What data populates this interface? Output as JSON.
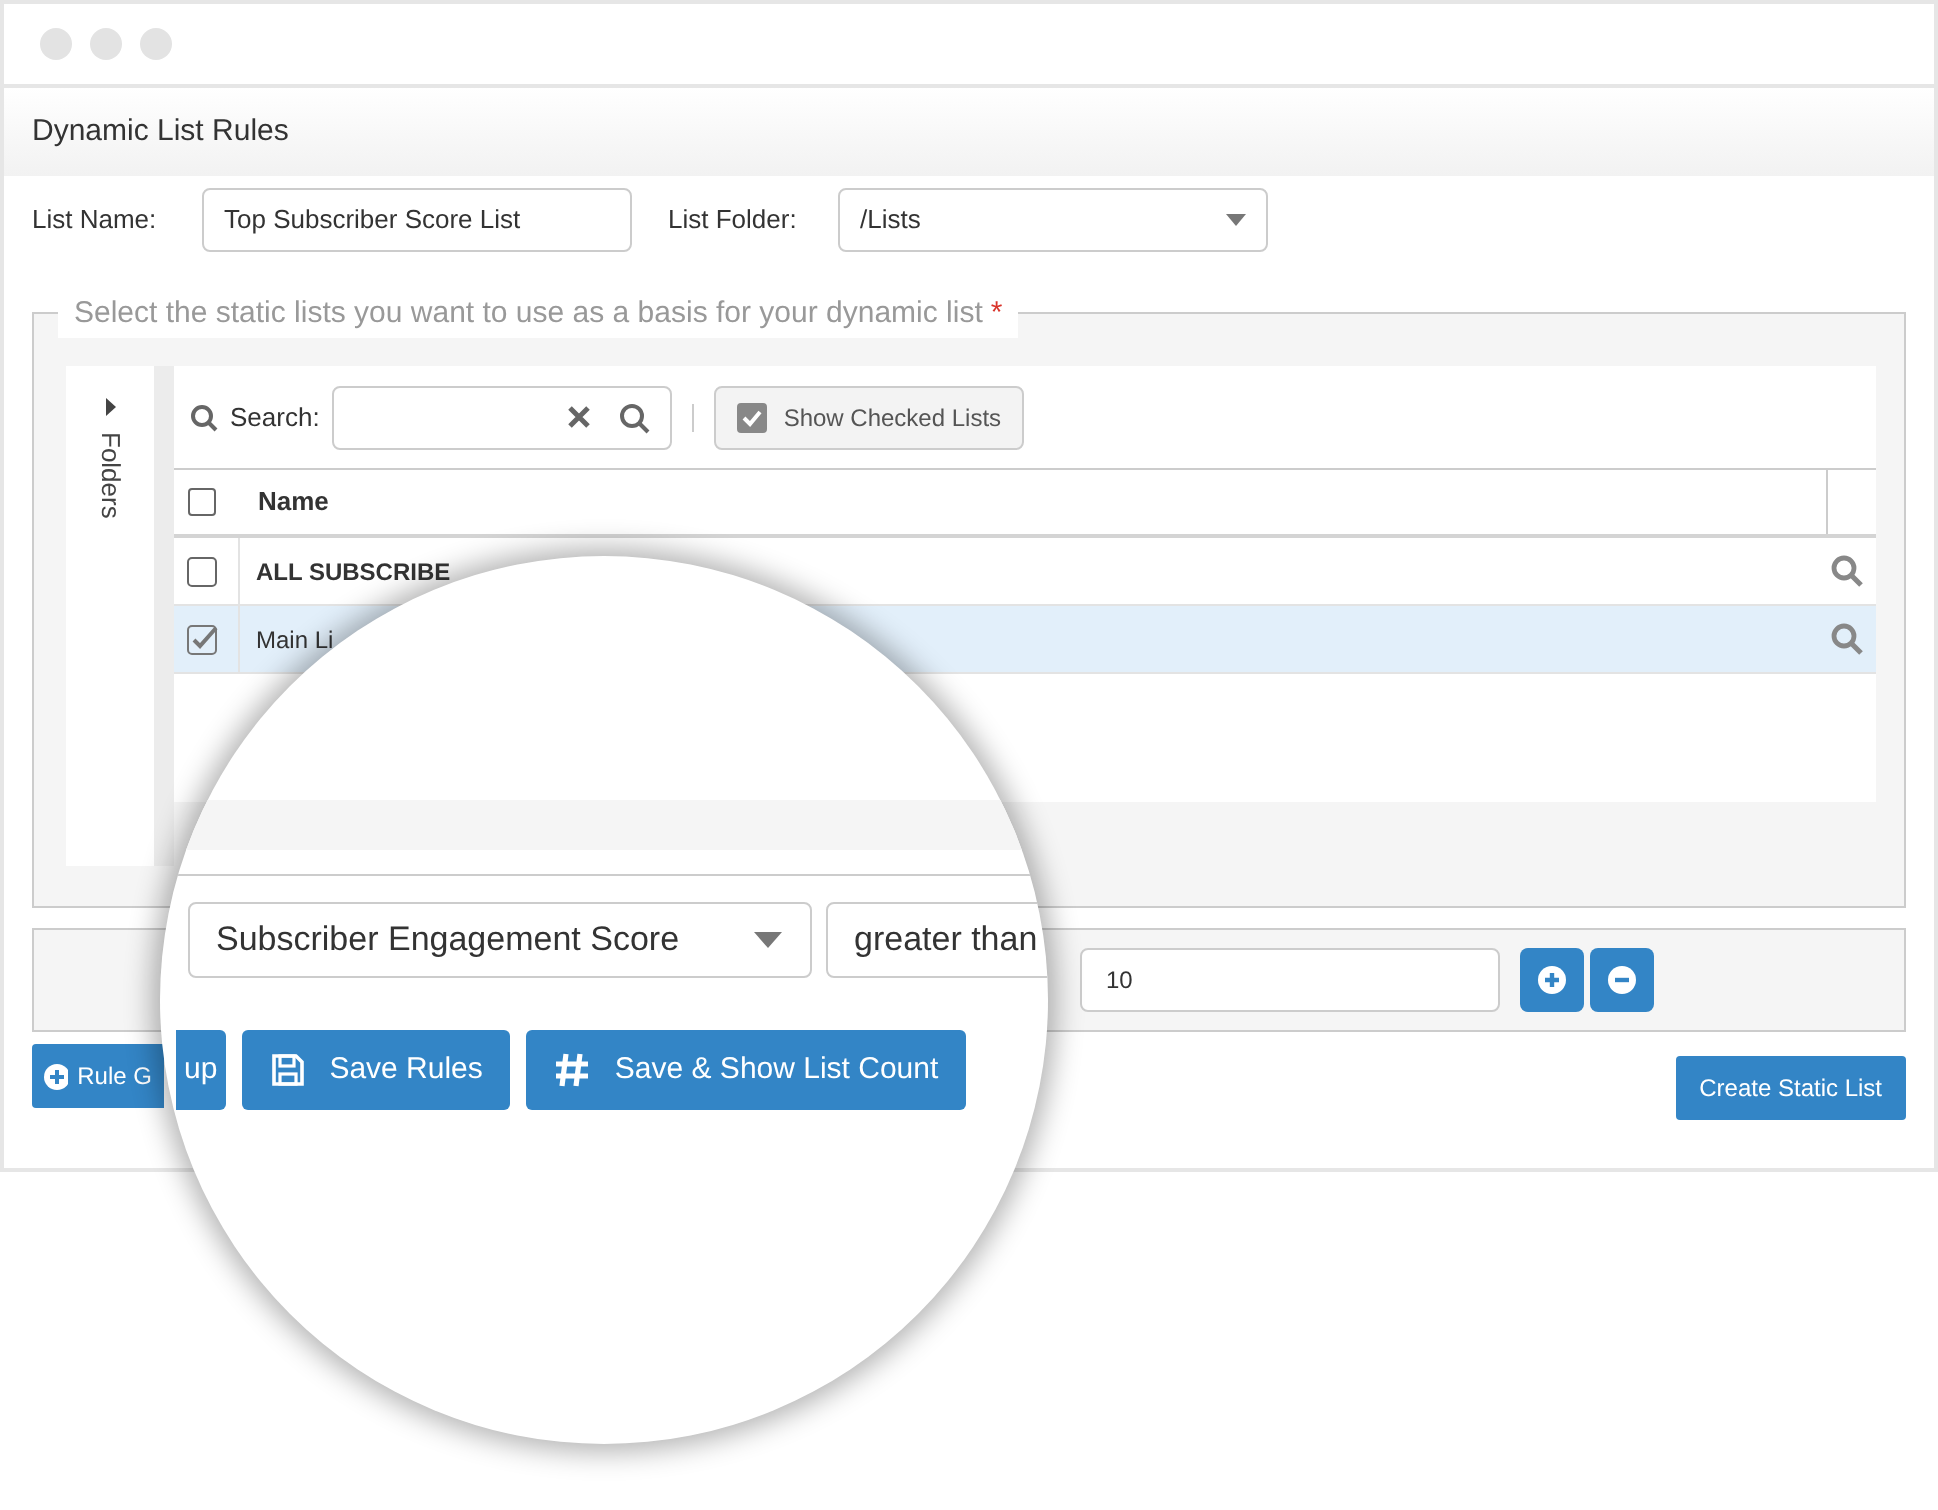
{
  "window": {
    "title": "Dynamic List Rules"
  },
  "form": {
    "list_name_label": "List Name:",
    "list_name": "Top Subscriber Score List",
    "list_folder_label": "List Folder:",
    "list_folder": "/Lists"
  },
  "static_lists": {
    "legend": "Select the static lists you want to use as a basis for your dynamic list",
    "required_mark": "*",
    "folders_label": "Folders",
    "search_label": "Search:",
    "show_checked": {
      "label": "Show Checked Lists",
      "checked": true
    },
    "header_checked": false,
    "columns": [
      "Name"
    ],
    "rows": [
      {
        "kind": "all",
        "name": "ALL SUBSCRIBE",
        "checked": false,
        "selected": false
      },
      {
        "kind": "list",
        "name": "Main Li",
        "checked": true,
        "selected": true
      }
    ]
  },
  "rule": {
    "value": "10"
  },
  "buttons": [
    {
      "label": "Rule G"
    },
    {
      "label": "Create Static List"
    }
  ],
  "magnifier": {
    "field": "Subscriber Engagement Score",
    "operator": "greater than",
    "buttons": [
      {
        "label": "up"
      },
      {
        "label": "Save Rules"
      },
      {
        "label": "Save & Show List Count"
      }
    ]
  }
}
